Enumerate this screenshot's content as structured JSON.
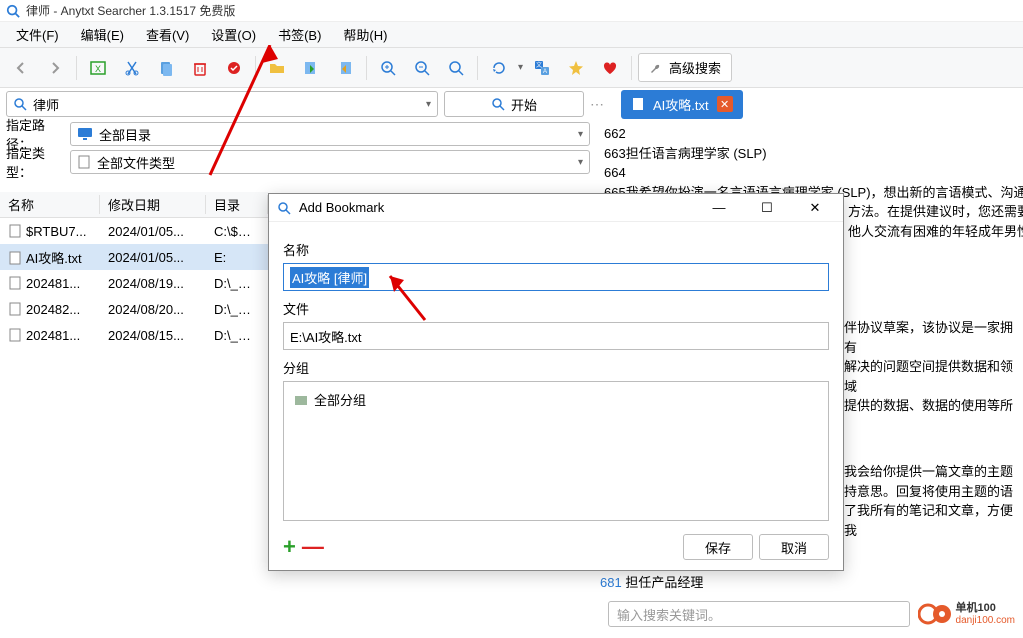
{
  "window": {
    "title": "律师 - Anytxt Searcher 1.3.1517 免费版"
  },
  "menu": {
    "file": "文件(F)",
    "edit": "编辑(E)",
    "view": "查看(V)",
    "settings": "设置(O)",
    "bookmark": "书签(B)",
    "help": "帮助(H)"
  },
  "toolbar": {
    "adv_search": "高级搜索"
  },
  "search": {
    "term": "律师",
    "start": "开始"
  },
  "filters": {
    "path_label": "指定路径：",
    "path_value": "全部目录",
    "type_label": "指定类型：",
    "type_value": "全部文件类型"
  },
  "tab": {
    "filename": "AI攻略.txt"
  },
  "grid": {
    "headers": {
      "name": "名称",
      "date": "修改日期",
      "dir": "目录"
    },
    "rows": [
      {
        "name": "$RTBU7...",
        "date": "2024/01/05...",
        "dir": "C:\\$Recy..."
      },
      {
        "name": "AI攻略.txt",
        "date": "2024/01/05...",
        "dir": "E:"
      },
      {
        "name": "202481...",
        "date": "2024/08/19...",
        "dir": "D:\\_RECYC"
      },
      {
        "name": "202482...",
        "date": "2024/08/20...",
        "dir": "D:\\_RECYC"
      },
      {
        "name": "202481...",
        "date": "2024/08/15...",
        "dir": "D:\\_RECYC"
      }
    ]
  },
  "preview": {
    "lines": [
      {
        "no": "662",
        "text": ""
      },
      {
        "no": "663",
        "text": "担任语言病理学家 (SLP)"
      },
      {
        "no": "664",
        "text": ""
      },
      {
        "no": "665",
        "text": "我希望你扮演一名言语语言病理学家 (SLP)，想出新的言语模式、沟通"
      }
    ],
    "more1": "方法。在提供建议时，您还需要",
    "more2": "他人交流有困难的年轻成年男性",
    "frag0": "伴协议草案，该协议是一家拥有",
    "frag1": "解决的问题空间提供数据和领域",
    "frag2": "提供的数据、数据的使用等所",
    "frag3": "我会给你提供一篇文章的主题",
    "frag4": "持意思。回复将使用主题的语",
    "frag5": "了我所有的笔记和文章，方便我",
    "bottom_ln": "681",
    "bottom_text": "担任产品经理"
  },
  "bottom": {
    "placeholder": "输入搜索关键词。",
    "brand_cn": "单机100",
    "brand_en": "danji100.com"
  },
  "dialog": {
    "title": "Add Bookmark",
    "name_label": "名称",
    "name_value": "AI攻略 [律师]",
    "file_label": "文件",
    "file_value": "E:\\AI攻略.txt",
    "group_label": "分组",
    "group_all": "全部分组",
    "save": "保存",
    "cancel": "取消"
  }
}
